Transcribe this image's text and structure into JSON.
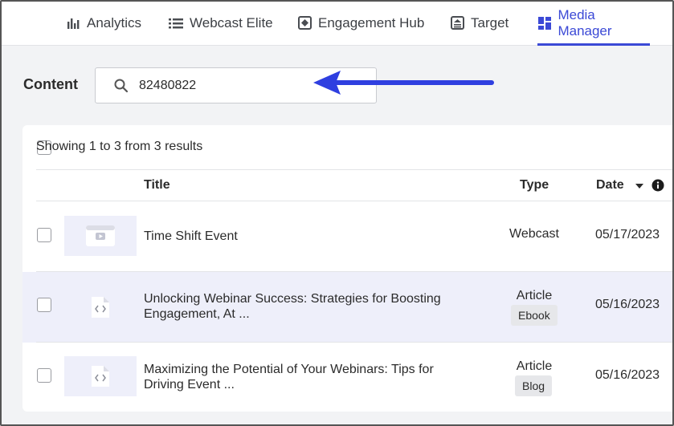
{
  "nav": {
    "tabs": [
      {
        "label": "Analytics",
        "icon": "bar-chart-icon",
        "active": false
      },
      {
        "label": "Webcast Elite",
        "icon": "list-icon",
        "active": false
      },
      {
        "label": "Engagement Hub",
        "icon": "hub-icon",
        "active": false
      },
      {
        "label": "Target",
        "icon": "target-icon",
        "active": false
      },
      {
        "label": "Media Manager",
        "icon": "dashboard-icon",
        "active": true
      }
    ]
  },
  "search": {
    "label": "Content",
    "value": "82480822",
    "icon": "search-icon"
  },
  "table": {
    "results_text": "Showing 1 to 3 from 3 results",
    "columns": {
      "title": "Title",
      "type": "Type",
      "date": "Date"
    },
    "sort": {
      "column": "Date",
      "direction": "descending"
    },
    "rows": [
      {
        "title_line1": "Time Shift Event",
        "title_line2": "",
        "type": "Webcast",
        "tag": "",
        "date": "05/17/2023",
        "thumb_icon": "video-icon",
        "highlighted": false
      },
      {
        "title_line1": "Unlocking Webinar Success: Strategies for Boosting",
        "title_line2": "Engagement, At ...",
        "type": "Article",
        "tag": "Ebook",
        "date": "05/16/2023",
        "thumb_icon": "code-file-icon",
        "highlighted": true
      },
      {
        "title_line1": "Maximizing the Potential of Your Webinars: Tips for",
        "title_line2": "Driving Event ...",
        "type": "Article",
        "tag": "Blog",
        "date": "05/16/2023",
        "thumb_icon": "code-file-icon",
        "highlighted": false
      }
    ]
  },
  "colors": {
    "accent": "#3b49d6",
    "arrow": "#2f3fe0",
    "row_highlight": "#eeeffa"
  }
}
